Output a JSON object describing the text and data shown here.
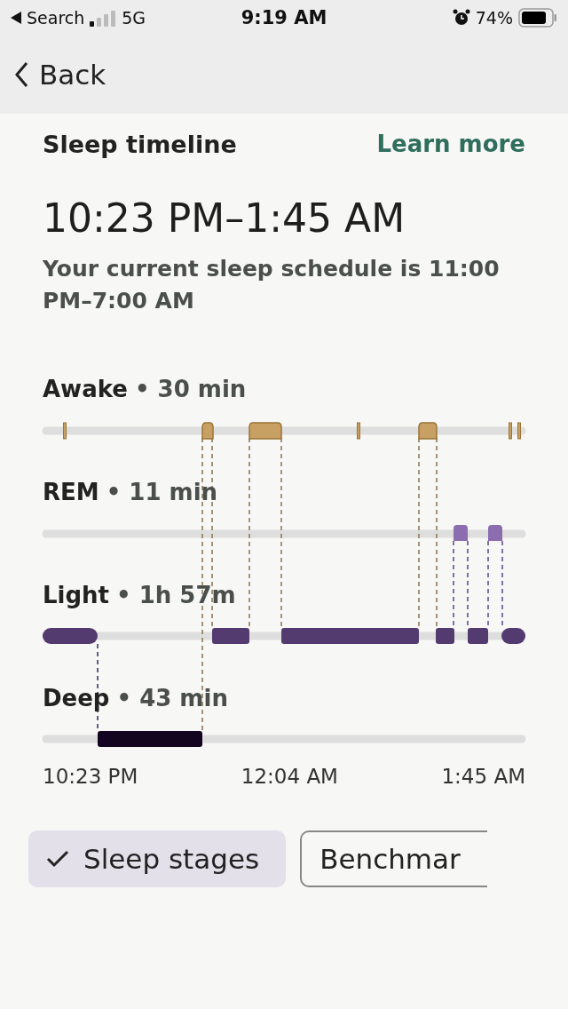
{
  "status_bar": {
    "back_app": "Search",
    "network": "5G",
    "time": "9:19 AM",
    "battery": "74%"
  },
  "nav": {
    "back": "Back"
  },
  "section": {
    "title": "Sleep timeline",
    "link": "Learn more"
  },
  "range": "10:23 PM–1:45 AM",
  "schedule": "Your current sleep schedule is 11:00 PM–7:00 AM",
  "stages": [
    {
      "name": "Awake",
      "duration": "• 30 min"
    },
    {
      "name": "REM",
      "duration": "• 11 min"
    },
    {
      "name": "Light",
      "duration": "• 1h 57m"
    },
    {
      "name": "Deep",
      "duration": "• 43 min"
    }
  ],
  "axis": [
    "10:23 PM",
    "12:04 AM",
    "1:45 AM"
  ],
  "chips": [
    {
      "label": "Sleep stages",
      "selected": true
    },
    {
      "label": "Benchmar",
      "selected": false
    }
  ]
}
